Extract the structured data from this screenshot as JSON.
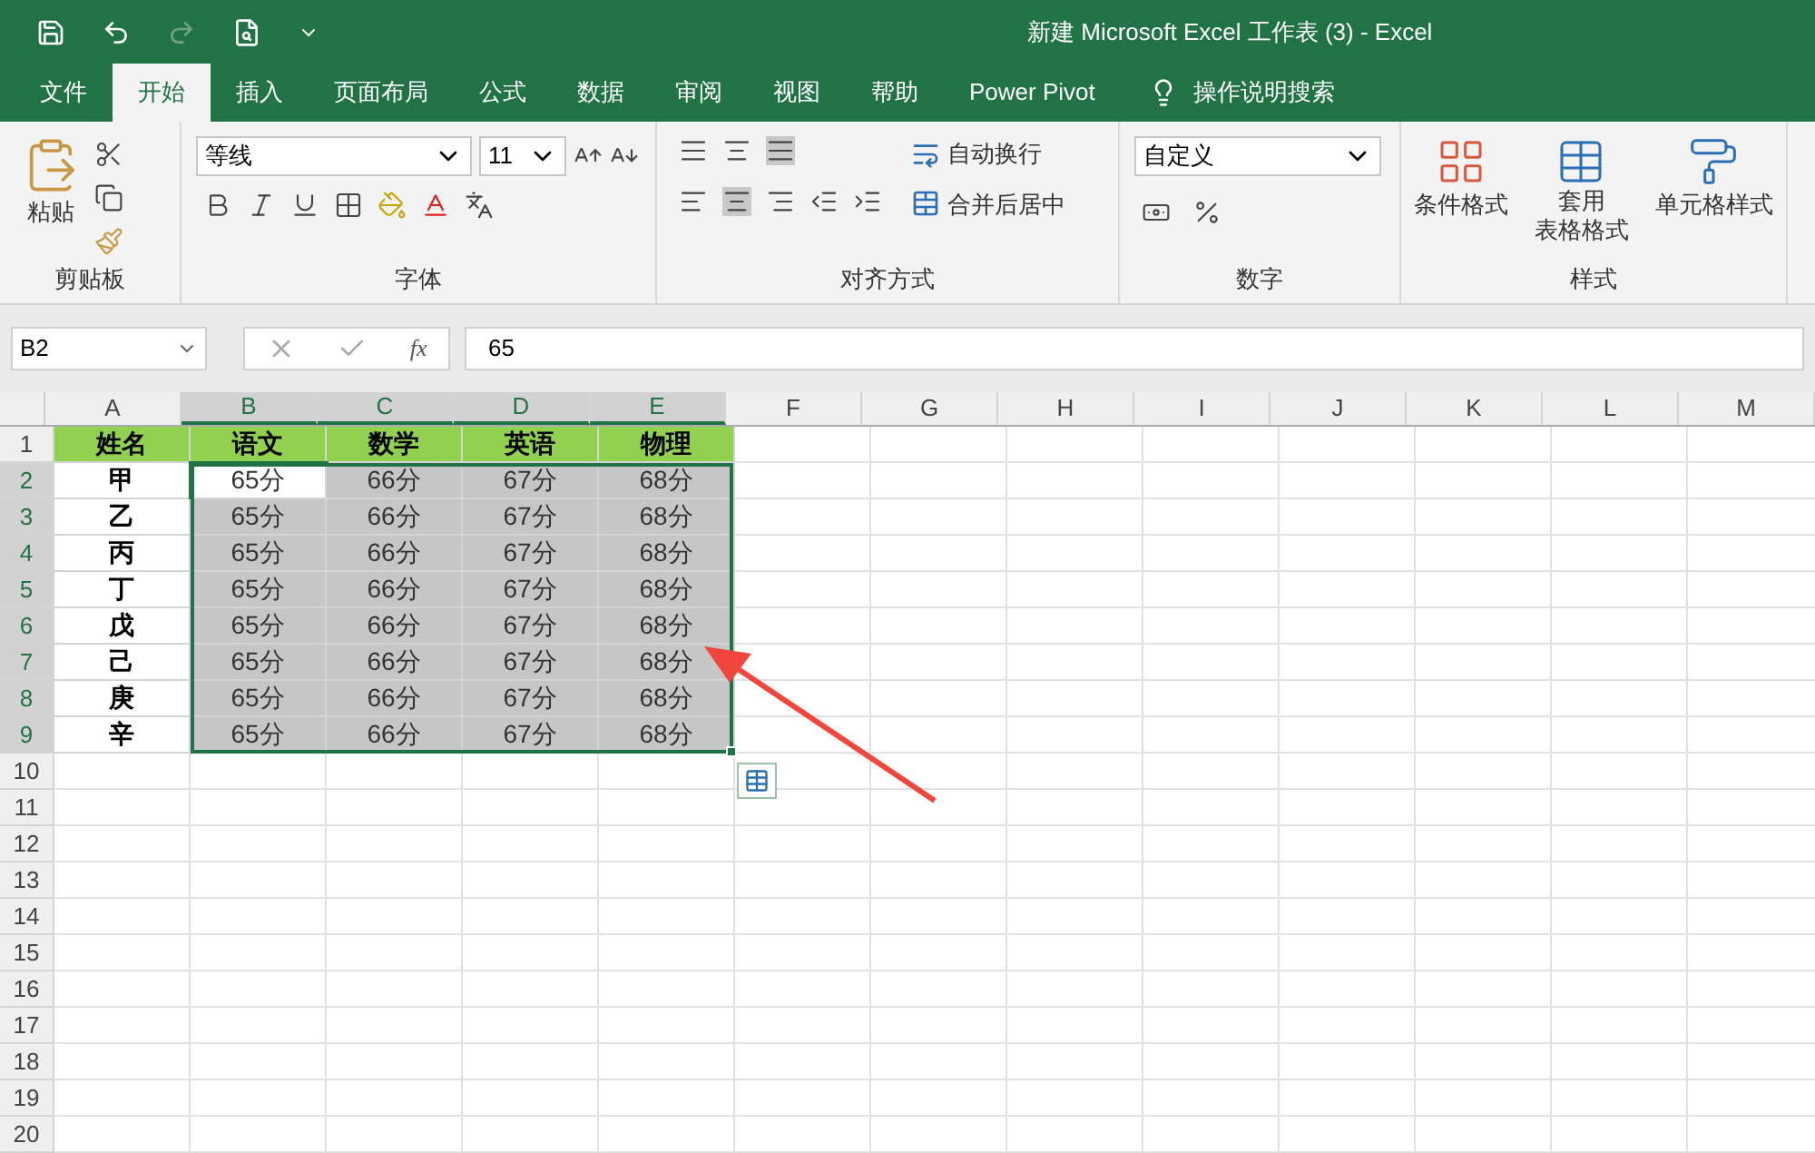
{
  "window": {
    "title": "新建 Microsoft Excel 工作表 (3)  -  Excel"
  },
  "quick_access": [
    {
      "kind": "save",
      "disabled": false
    },
    {
      "kind": "undo",
      "disabled": false
    },
    {
      "kind": "redo",
      "disabled": true
    },
    {
      "kind": "preview",
      "disabled": false
    },
    {
      "kind": "customize",
      "disabled": false
    }
  ],
  "tabs": [
    {
      "label": "文件",
      "selected": false
    },
    {
      "label": "开始",
      "selected": true
    },
    {
      "label": "插入",
      "selected": false
    },
    {
      "label": "页面布局",
      "selected": false
    },
    {
      "label": "公式",
      "selected": false
    },
    {
      "label": "数据",
      "selected": false
    },
    {
      "label": "审阅",
      "selected": false
    },
    {
      "label": "视图",
      "selected": false
    },
    {
      "label": "帮助",
      "selected": false
    },
    {
      "label": "Power Pivot",
      "selected": false
    }
  ],
  "tell_me": {
    "placeholder": "操作说明搜索"
  },
  "ribbon": {
    "clipboard": {
      "paste": "粘贴",
      "label": "剪贴板"
    },
    "font": {
      "font_name": "等线",
      "font_size": "11",
      "label": "字体"
    },
    "alignment": {
      "wrap_text": "自动换行",
      "merge_center": "合并后居中",
      "label": "对齐方式"
    },
    "number": {
      "format": "自定义",
      "label": "数字"
    },
    "styles": {
      "conditional": "条件格式",
      "table_format_1": "套用",
      "table_format_2": "表格格式",
      "cell_styles": "单元格样式",
      "label": "样式"
    }
  },
  "formula_bar": {
    "name_box": "B2",
    "fx": "fx",
    "formula": "65"
  },
  "sheet": {
    "columns": [
      {
        "label": "A",
        "selected": false
      },
      {
        "label": "B",
        "selected": true
      },
      {
        "label": "C",
        "selected": true
      },
      {
        "label": "D",
        "selected": true
      },
      {
        "label": "E",
        "selected": true
      },
      {
        "label": "F",
        "selected": false
      },
      {
        "label": "G",
        "selected": false
      },
      {
        "label": "H",
        "selected": false
      },
      {
        "label": "I",
        "selected": false
      },
      {
        "label": "J",
        "selected": false
      },
      {
        "label": "K",
        "selected": false
      },
      {
        "label": "L",
        "selected": false
      },
      {
        "label": "M",
        "selected": false
      }
    ],
    "rows": [
      {
        "number": "1",
        "selected": false,
        "kind": "header",
        "cells": [
          {
            "text": "姓名"
          },
          {
            "text": "语文"
          },
          {
            "text": "数学"
          },
          {
            "text": "英语"
          },
          {
            "text": "物理"
          }
        ]
      },
      {
        "number": "2",
        "selected": true,
        "kind": "data",
        "cells": [
          {
            "text": "甲",
            "selected": false,
            "active": false
          },
          {
            "text": "65分",
            "selected": true,
            "active": true
          },
          {
            "text": "66分",
            "selected": true,
            "active": false
          },
          {
            "text": "67分",
            "selected": true,
            "active": false
          },
          {
            "text": "68分",
            "selected": true,
            "active": false
          }
        ]
      },
      {
        "number": "3",
        "selected": true,
        "kind": "data",
        "cells": [
          {
            "text": "乙",
            "selected": false,
            "active": false
          },
          {
            "text": "65分",
            "selected": true,
            "active": false
          },
          {
            "text": "66分",
            "selected": true,
            "active": false
          },
          {
            "text": "67分",
            "selected": true,
            "active": false
          },
          {
            "text": "68分",
            "selected": true,
            "active": false
          }
        ]
      },
      {
        "number": "4",
        "selected": true,
        "kind": "data",
        "cells": [
          {
            "text": "丙",
            "selected": false,
            "active": false
          },
          {
            "text": "65分",
            "selected": true,
            "active": false
          },
          {
            "text": "66分",
            "selected": true,
            "active": false
          },
          {
            "text": "67分",
            "selected": true,
            "active": false
          },
          {
            "text": "68分",
            "selected": true,
            "active": false
          }
        ]
      },
      {
        "number": "5",
        "selected": true,
        "kind": "data",
        "cells": [
          {
            "text": "丁",
            "selected": false,
            "active": false
          },
          {
            "text": "65分",
            "selected": true,
            "active": false
          },
          {
            "text": "66分",
            "selected": true,
            "active": false
          },
          {
            "text": "67分",
            "selected": true,
            "active": false
          },
          {
            "text": "68分",
            "selected": true,
            "active": false
          }
        ]
      },
      {
        "number": "6",
        "selected": true,
        "kind": "data",
        "cells": [
          {
            "text": "戊",
            "selected": false,
            "active": false
          },
          {
            "text": "65分",
            "selected": true,
            "active": false
          },
          {
            "text": "66分",
            "selected": true,
            "active": false
          },
          {
            "text": "67分",
            "selected": true,
            "active": false
          },
          {
            "text": "68分",
            "selected": true,
            "active": false
          }
        ]
      },
      {
        "number": "7",
        "selected": true,
        "kind": "data",
        "cells": [
          {
            "text": "己",
            "selected": false,
            "active": false
          },
          {
            "text": "65分",
            "selected": true,
            "active": false
          },
          {
            "text": "66分",
            "selected": true,
            "active": false
          },
          {
            "text": "67分",
            "selected": true,
            "active": false
          },
          {
            "text": "68分",
            "selected": true,
            "active": false
          }
        ]
      },
      {
        "number": "8",
        "selected": true,
        "kind": "data",
        "cells": [
          {
            "text": "庚",
            "selected": false,
            "active": false
          },
          {
            "text": "65分",
            "selected": true,
            "active": false
          },
          {
            "text": "66分",
            "selected": true,
            "active": false
          },
          {
            "text": "67分",
            "selected": true,
            "active": false
          },
          {
            "text": "68分",
            "selected": true,
            "active": false
          }
        ]
      },
      {
        "number": "9",
        "selected": true,
        "kind": "data",
        "cells": [
          {
            "text": "辛",
            "selected": false,
            "active": false
          },
          {
            "text": "65分",
            "selected": true,
            "active": false
          },
          {
            "text": "66分",
            "selected": true,
            "active": false
          },
          {
            "text": "67分",
            "selected": true,
            "active": false
          },
          {
            "text": "68分",
            "selected": true,
            "active": false
          }
        ]
      },
      {
        "number": "10",
        "selected": false,
        "kind": "empty",
        "cells": []
      },
      {
        "number": "11",
        "selected": false,
        "kind": "empty",
        "cells": []
      },
      {
        "number": "12",
        "selected": false,
        "kind": "empty",
        "cells": []
      },
      {
        "number": "13",
        "selected": false,
        "kind": "empty",
        "cells": []
      },
      {
        "number": "14",
        "selected": false,
        "kind": "empty",
        "cells": []
      },
      {
        "number": "15",
        "selected": false,
        "kind": "empty",
        "cells": []
      },
      {
        "number": "16",
        "selected": false,
        "kind": "empty",
        "cells": []
      },
      {
        "number": "17",
        "selected": false,
        "kind": "empty",
        "cells": []
      },
      {
        "number": "18",
        "selected": false,
        "kind": "empty",
        "cells": []
      },
      {
        "number": "19",
        "selected": false,
        "kind": "empty",
        "cells": []
      },
      {
        "number": "20",
        "selected": false,
        "kind": "empty",
        "cells": []
      }
    ]
  }
}
